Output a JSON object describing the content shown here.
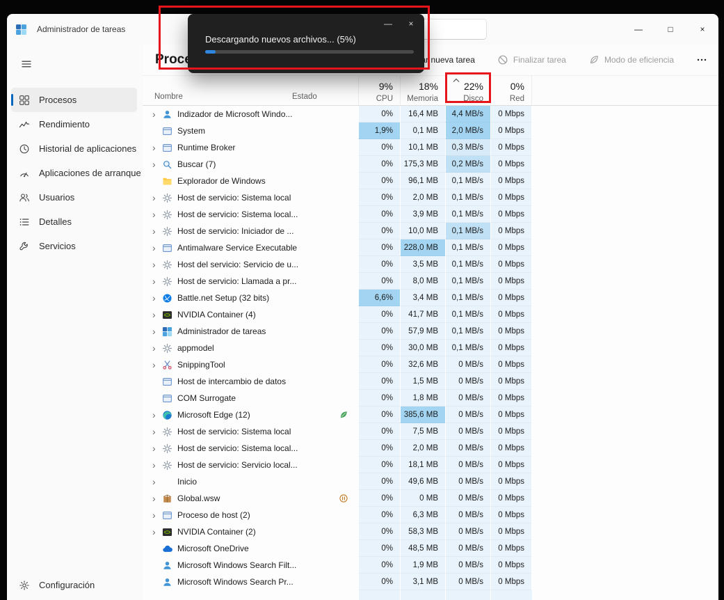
{
  "colors": {
    "accent": "#0067c0",
    "annotation_red": "#e8141c",
    "heat_levels": [
      "#e9f3fb",
      "#d7eaf8",
      "#c0e0f5",
      "#a3d5f2"
    ],
    "toast_background": "#202020",
    "toast_progress": "#2f86e0"
  },
  "titlebar": {
    "title": "Administrador de tareas",
    "window_controls": [
      {
        "name": "minimize-button",
        "glyph": "—"
      },
      {
        "name": "maximize-button",
        "glyph": "□"
      },
      {
        "name": "close-button",
        "glyph": "×"
      }
    ]
  },
  "toast": {
    "message": "Descargando nuevos archivos... (5%)",
    "progress_percent": 5,
    "minimize_glyph": "—",
    "close_glyph": "×"
  },
  "sidebar": {
    "items": [
      {
        "label": "Procesos",
        "icon": "processes-icon",
        "selected": true
      },
      {
        "label": "Rendimiento",
        "icon": "performance-icon",
        "selected": false
      },
      {
        "label": "Historial de aplicaciones",
        "icon": "history-icon",
        "selected": false
      },
      {
        "label": "Aplicaciones de arranque",
        "icon": "startup-icon",
        "selected": false
      },
      {
        "label": "Usuarios",
        "icon": "users-icon",
        "selected": false
      },
      {
        "label": "Detalles",
        "icon": "details-icon",
        "selected": false
      },
      {
        "label": "Servicios",
        "icon": "services-icon",
        "selected": false
      }
    ],
    "bottom_item": {
      "label": "Configuración",
      "icon": "settings-icon",
      "selected": false
    }
  },
  "toolbar": {
    "page_title": "Procesos",
    "buttons": [
      {
        "name": "run-new-task-button",
        "label": "Ejecutar nueva tarea",
        "icon": "new-task-icon",
        "enabled": true
      },
      {
        "name": "end-task-button",
        "label": "Finalizar tarea",
        "icon": "end-task-icon",
        "enabled": false
      },
      {
        "name": "efficiency-mode-button",
        "label": "Modo de eficiencia",
        "icon": "efficiency-icon",
        "enabled": false
      },
      {
        "name": "more-options-button",
        "label": "",
        "icon": "more-icon",
        "enabled": true
      }
    ]
  },
  "table": {
    "name_header": "Nombre",
    "status_header": "Estado",
    "metric_headers": [
      {
        "percent": "9%",
        "label": "CPU",
        "sorted": false
      },
      {
        "percent": "18%",
        "label": "Memoria",
        "sorted": false
      },
      {
        "percent": "22%",
        "label": "Disco",
        "sorted": true
      },
      {
        "percent": "0%",
        "label": "Red",
        "sorted": false
      }
    ],
    "rows": [
      {
        "name": "Indizador de Microsoft Windo...",
        "icon": "person-icon",
        "expandable": true,
        "status": "",
        "cpu": "0%",
        "memory": "16,4 MB",
        "disk": "4,4 MB/s",
        "network": "0 Mbps",
        "heat": {
          "disk": 3
        }
      },
      {
        "name": "System",
        "icon": "window-icon",
        "expandable": false,
        "status": "",
        "cpu": "1,9%",
        "memory": "0,1 MB",
        "disk": "2,0 MB/s",
        "network": "0 Mbps",
        "heat": {
          "cpu": 3,
          "disk": 3
        }
      },
      {
        "name": "Runtime Broker",
        "icon": "window-icon",
        "expandable": true,
        "status": "",
        "cpu": "0%",
        "memory": "10,1 MB",
        "disk": "0,3 MB/s",
        "network": "0 Mbps",
        "heat": {
          "disk": 1
        }
      },
      {
        "name": "Buscar (7)",
        "icon": "search-icon",
        "expandable": true,
        "status": "",
        "cpu": "0%",
        "memory": "175,3 MB",
        "disk": "0,2 MB/s",
        "network": "0 Mbps",
        "heat": {
          "disk": 2
        }
      },
      {
        "name": "Explorador de Windows",
        "icon": "folder-icon",
        "expandable": false,
        "status": "",
        "cpu": "0%",
        "memory": "96,1 MB",
        "disk": "0,1 MB/s",
        "network": "0 Mbps"
      },
      {
        "name": "Host de servicio: Sistema local",
        "icon": "gear-icon",
        "expandable": true,
        "status": "",
        "cpu": "0%",
        "memory": "2,0 MB",
        "disk": "0,1 MB/s",
        "network": "0 Mbps"
      },
      {
        "name": "Host de servicio: Sistema local...",
        "icon": "gear-icon",
        "expandable": true,
        "status": "",
        "cpu": "0%",
        "memory": "3,9 MB",
        "disk": "0,1 MB/s",
        "network": "0 Mbps"
      },
      {
        "name": "Host de servicio: Iniciador de ...",
        "icon": "gear-icon",
        "expandable": true,
        "status": "",
        "cpu": "0%",
        "memory": "10,0 MB",
        "disk": "0,1 MB/s",
        "network": "0 Mbps",
        "heat": {
          "disk": 2
        }
      },
      {
        "name": "Antimalware Service Executable",
        "icon": "window-icon",
        "expandable": true,
        "status": "",
        "cpu": "0%",
        "memory": "228,0 MB",
        "disk": "0,1 MB/s",
        "network": "0 Mbps",
        "heat": {
          "mem": 3
        }
      },
      {
        "name": "Host del servicio: Servicio de u...",
        "icon": "gear-icon",
        "expandable": true,
        "status": "",
        "cpu": "0%",
        "memory": "3,5 MB",
        "disk": "0,1 MB/s",
        "network": "0 Mbps"
      },
      {
        "name": "Host de servicio: Llamada a pr...",
        "icon": "gear-icon",
        "expandable": true,
        "status": "",
        "cpu": "0%",
        "memory": "8,0 MB",
        "disk": "0,1 MB/s",
        "network": "0 Mbps"
      },
      {
        "name": "Battle.net Setup (32 bits)",
        "icon": "battlenet-icon",
        "expandable": true,
        "status": "",
        "cpu": "6,6%",
        "memory": "3,4 MB",
        "disk": "0,1 MB/s",
        "network": "0 Mbps",
        "heat": {
          "cpu": 3
        }
      },
      {
        "name": "NVIDIA Container (4)",
        "icon": "nvidia-icon",
        "expandable": true,
        "status": "",
        "cpu": "0%",
        "memory": "41,7 MB",
        "disk": "0,1 MB/s",
        "network": "0 Mbps"
      },
      {
        "name": "Administrador de tareas",
        "icon": "task-manager-icon",
        "expandable": true,
        "status": "",
        "cpu": "0%",
        "memory": "57,9 MB",
        "disk": "0,1 MB/s",
        "network": "0 Mbps"
      },
      {
        "name": "appmodel",
        "icon": "gear-icon",
        "expandable": true,
        "status": "",
        "cpu": "0%",
        "memory": "30,0 MB",
        "disk": "0,1 MB/s",
        "network": "0 Mbps"
      },
      {
        "name": "SnippingTool",
        "icon": "snipping-tool-icon",
        "expandable": true,
        "status": "",
        "cpu": "0%",
        "memory": "32,6 MB",
        "disk": "0 MB/s",
        "network": "0 Mbps"
      },
      {
        "name": "Host de intercambio de datos",
        "icon": "window-icon",
        "expandable": false,
        "status": "",
        "cpu": "0%",
        "memory": "1,5 MB",
        "disk": "0 MB/s",
        "network": "0 Mbps"
      },
      {
        "name": "COM Surrogate",
        "icon": "window-icon",
        "expandable": false,
        "status": "",
        "cpu": "0%",
        "memory": "1,8 MB",
        "disk": "0 MB/s",
        "network": "0 Mbps"
      },
      {
        "name": "Microsoft Edge (12)",
        "icon": "edge-icon",
        "expandable": true,
        "status": "leaf-icon",
        "cpu": "0%",
        "memory": "385,6 MB",
        "disk": "0 MB/s",
        "network": "0 Mbps",
        "heat": {
          "mem": 3
        }
      },
      {
        "name": "Host de servicio: Sistema local",
        "icon": "gear-icon",
        "expandable": true,
        "status": "",
        "cpu": "0%",
        "memory": "7,5 MB",
        "disk": "0 MB/s",
        "network": "0 Mbps"
      },
      {
        "name": "Host de servicio: Sistema local...",
        "icon": "gear-icon",
        "expandable": true,
        "status": "",
        "cpu": "0%",
        "memory": "2,0 MB",
        "disk": "0 MB/s",
        "network": "0 Mbps"
      },
      {
        "name": "Host de servicio: Servicio local...",
        "icon": "gear-icon",
        "expandable": true,
        "status": "",
        "cpu": "0%",
        "memory": "18,1 MB",
        "disk": "0 MB/s",
        "network": "0 Mbps"
      },
      {
        "name": "Inicio",
        "icon": "",
        "expandable": true,
        "status": "",
        "cpu": "0%",
        "memory": "49,6 MB",
        "disk": "0 MB/s",
        "network": "0 Mbps"
      },
      {
        "name": "Global.wsw",
        "icon": "package-icon",
        "expandable": true,
        "status": "pause-icon",
        "cpu": "0%",
        "memory": "0 MB",
        "disk": "0 MB/s",
        "network": "0 Mbps"
      },
      {
        "name": "Proceso de host (2)",
        "icon": "window-icon",
        "expandable": true,
        "status": "",
        "cpu": "0%",
        "memory": "6,3 MB",
        "disk": "0 MB/s",
        "network": "0 Mbps"
      },
      {
        "name": "NVIDIA Container (2)",
        "icon": "nvidia-icon",
        "expandable": true,
        "status": "",
        "cpu": "0%",
        "memory": "58,3 MB",
        "disk": "0 MB/s",
        "network": "0 Mbps"
      },
      {
        "name": "Microsoft OneDrive",
        "icon": "onedrive-icon",
        "expandable": false,
        "status": "",
        "cpu": "0%",
        "memory": "48,5 MB",
        "disk": "0 MB/s",
        "network": "0 Mbps"
      },
      {
        "name": "Microsoft Windows Search Filt...",
        "icon": "person-icon",
        "expandable": false,
        "status": "",
        "cpu": "0%",
        "memory": "1,9 MB",
        "disk": "0 MB/s",
        "network": "0 Mbps"
      },
      {
        "name": "Microsoft Windows Search Pr...",
        "icon": "person-icon",
        "expandable": false,
        "status": "",
        "cpu": "0%",
        "memory": "3,1 MB",
        "disk": "0 MB/s",
        "network": "0 Mbps"
      }
    ]
  },
  "annotations": {
    "boxes": [
      "download-toast",
      "disk-column-header"
    ]
  }
}
